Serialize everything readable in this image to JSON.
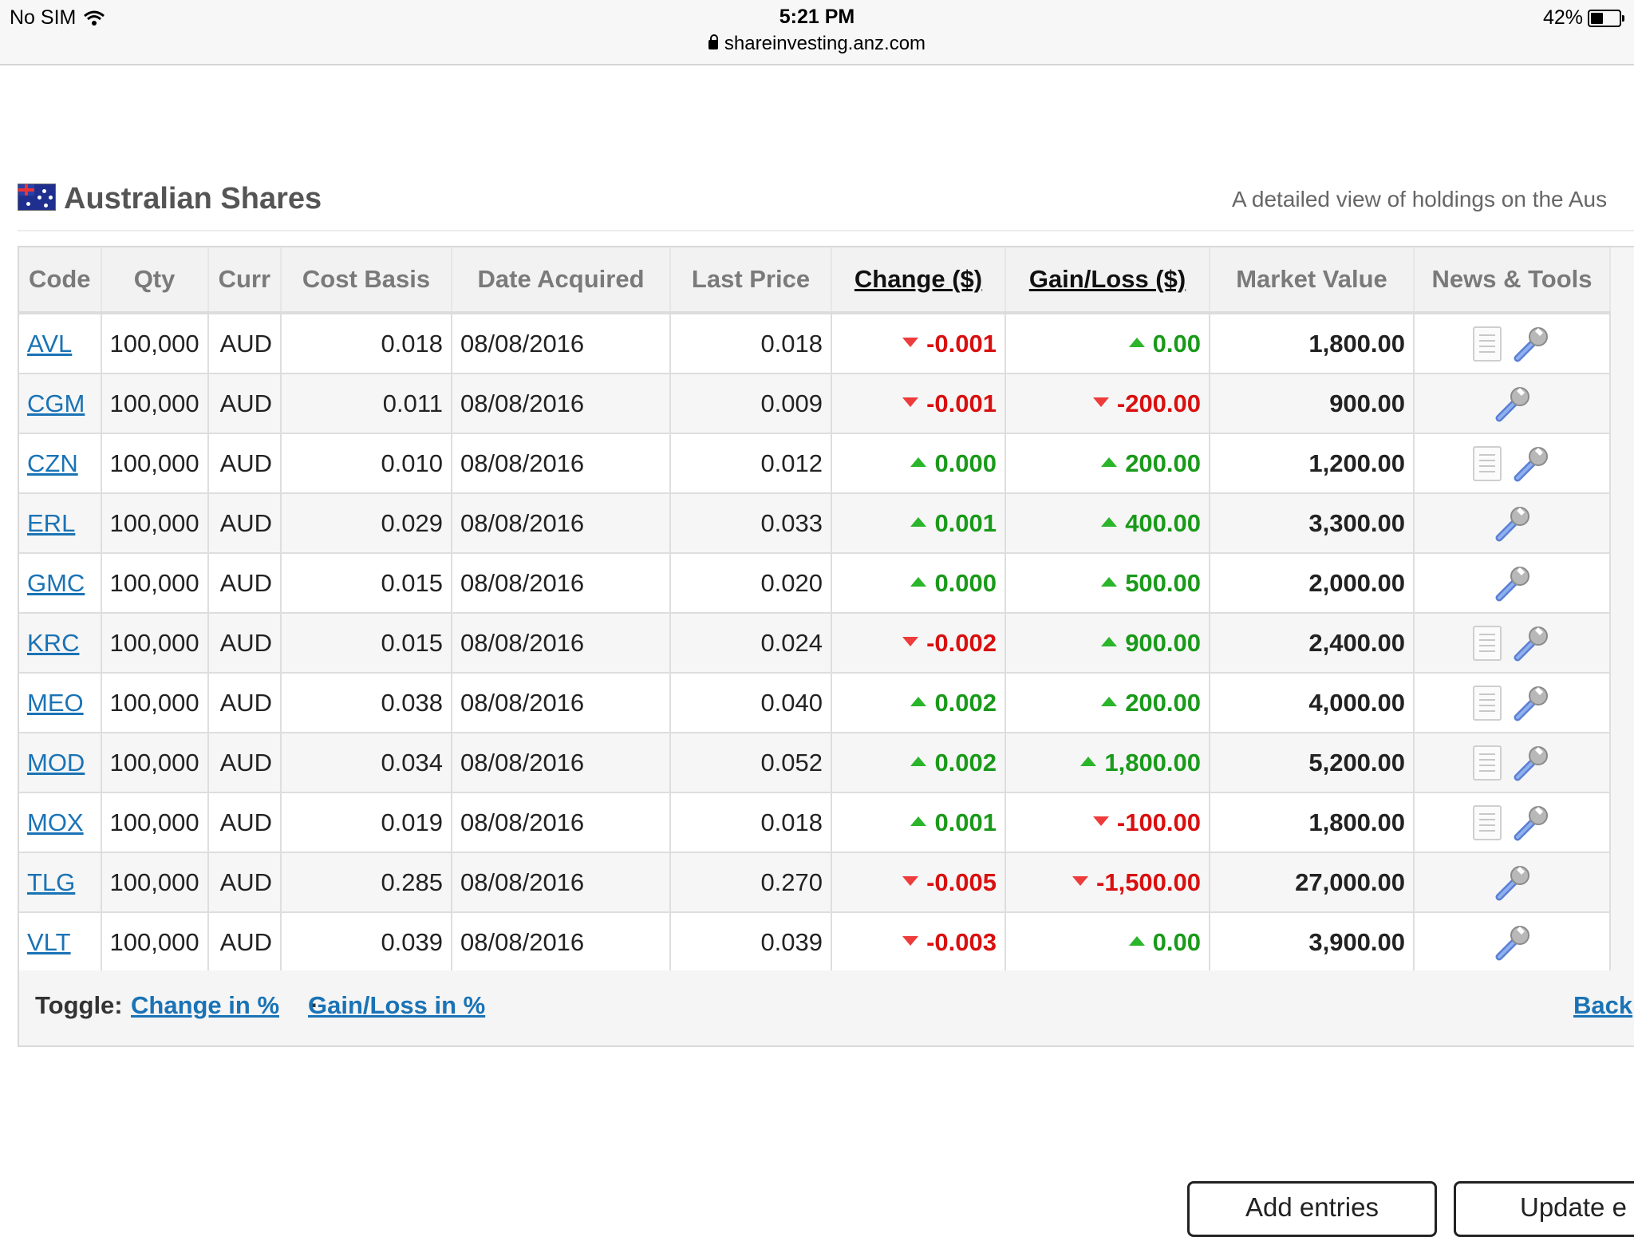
{
  "status_bar": {
    "carrier": "No SIM",
    "time": "5:21 PM",
    "url": "shareinvesting.anz.com",
    "battery": "42%"
  },
  "section": {
    "title": "Australian Shares",
    "description": "A detailed view of holdings on the Aus"
  },
  "table": {
    "headers": [
      "Code",
      "Qty",
      "Curr",
      "Cost Basis",
      "Date Acquired",
      "Last Price",
      "Change ($)",
      "Gain/Loss ($)",
      "Market Value",
      "News & Tools"
    ],
    "rows": [
      {
        "code": "AVL",
        "qty": "100,000",
        "curr": "AUD",
        "cost": "0.018",
        "date": "08/08/2016",
        "last": "0.018",
        "change": "-0.001",
        "change_dir": "down",
        "gain": "0.00",
        "gain_dir": "up",
        "mv": "1,800.00",
        "news": true
      },
      {
        "code": "CGM",
        "qty": "100,000",
        "curr": "AUD",
        "cost": "0.011",
        "date": "08/08/2016",
        "last": "0.009",
        "change": "-0.001",
        "change_dir": "down",
        "gain": "-200.00",
        "gain_dir": "down",
        "mv": "900.00",
        "news": false
      },
      {
        "code": "CZN",
        "qty": "100,000",
        "curr": "AUD",
        "cost": "0.010",
        "date": "08/08/2016",
        "last": "0.012",
        "change": "0.000",
        "change_dir": "up",
        "gain": "200.00",
        "gain_dir": "up",
        "mv": "1,200.00",
        "news": true
      },
      {
        "code": "ERL",
        "qty": "100,000",
        "curr": "AUD",
        "cost": "0.029",
        "date": "08/08/2016",
        "last": "0.033",
        "change": "0.001",
        "change_dir": "up",
        "gain": "400.00",
        "gain_dir": "up",
        "mv": "3,300.00",
        "news": false
      },
      {
        "code": "GMC",
        "qty": "100,000",
        "curr": "AUD",
        "cost": "0.015",
        "date": "08/08/2016",
        "last": "0.020",
        "change": "0.000",
        "change_dir": "up",
        "gain": "500.00",
        "gain_dir": "up",
        "mv": "2,000.00",
        "news": false
      },
      {
        "code": "KRC",
        "qty": "100,000",
        "curr": "AUD",
        "cost": "0.015",
        "date": "08/08/2016",
        "last": "0.024",
        "change": "-0.002",
        "change_dir": "down",
        "gain": "900.00",
        "gain_dir": "up",
        "mv": "2,400.00",
        "news": true
      },
      {
        "code": "MEO",
        "qty": "100,000",
        "curr": "AUD",
        "cost": "0.038",
        "date": "08/08/2016",
        "last": "0.040",
        "change": "0.002",
        "change_dir": "up",
        "gain": "200.00",
        "gain_dir": "up",
        "mv": "4,000.00",
        "news": true
      },
      {
        "code": "MOD",
        "qty": "100,000",
        "curr": "AUD",
        "cost": "0.034",
        "date": "08/08/2016",
        "last": "0.052",
        "change": "0.002",
        "change_dir": "up",
        "gain": "1,800.00",
        "gain_dir": "up",
        "mv": "5,200.00",
        "news": true
      },
      {
        "code": "MOX",
        "qty": "100,000",
        "curr": "AUD",
        "cost": "0.019",
        "date": "08/08/2016",
        "last": "0.018",
        "change": "0.001",
        "change_dir": "up",
        "gain": "-100.00",
        "gain_dir": "down",
        "mv": "1,800.00",
        "news": true
      },
      {
        "code": "TLG",
        "qty": "100,000",
        "curr": "AUD",
        "cost": "0.285",
        "date": "08/08/2016",
        "last": "0.270",
        "change": "-0.005",
        "change_dir": "down",
        "gain": "-1,500.00",
        "gain_dir": "down",
        "mv": "27,000.00",
        "news": false
      },
      {
        "code": "VLT",
        "qty": "100,000",
        "curr": "AUD",
        "cost": "0.039",
        "date": "08/08/2016",
        "last": "0.039",
        "change": "-0.003",
        "change_dir": "down",
        "gain": "0.00",
        "gain_dir": "up",
        "mv": "3,900.00",
        "news": false
      }
    ]
  },
  "toggle": {
    "label": "Toggle:",
    "change_pct": "Change in %",
    "separator": "·",
    "gain_pct": "Gain/Loss in %",
    "back": "Back"
  },
  "buttons": {
    "add": "Add entries",
    "update": "Update e"
  },
  "colors": {
    "link": "#1a73b5",
    "up": "#1a9a1a",
    "down": "#d90f0f"
  }
}
